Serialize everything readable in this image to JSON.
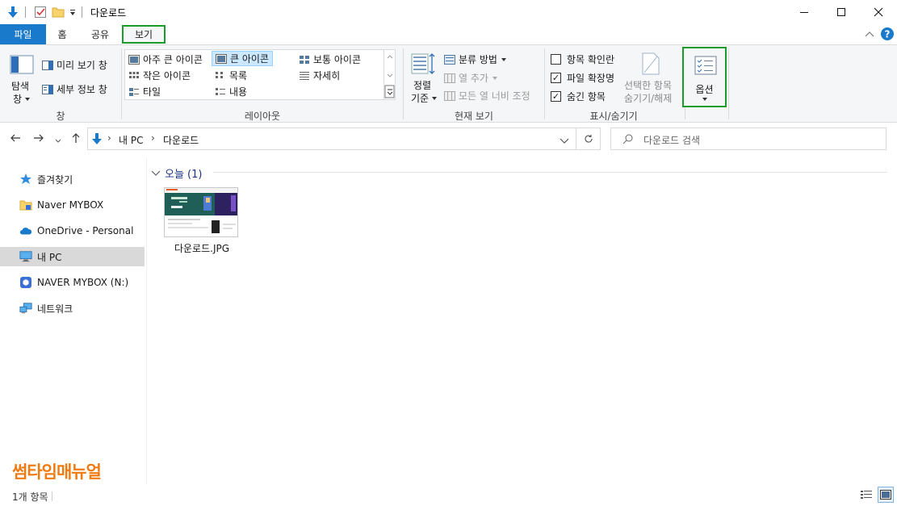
{
  "window": {
    "title": "다운로드"
  },
  "tabs": [
    {
      "label": "파일"
    },
    {
      "label": "홈"
    },
    {
      "label": "공유"
    },
    {
      "label": "보기"
    }
  ],
  "ribbon": {
    "pane": {
      "nav_pane_label_1": "탐색",
      "nav_pane_label_2": "창",
      "preview_label": "미리 보기 창",
      "details_label": "세부 정보 창",
      "group_label": "창"
    },
    "layout": {
      "items": [
        {
          "label": "아주 큰 아이콘"
        },
        {
          "label": "큰 아이콘"
        },
        {
          "label": "보통 아이콘"
        },
        {
          "label": "작은 아이콘"
        },
        {
          "label": "목록"
        },
        {
          "label": "자세히"
        },
        {
          "label": "타일"
        },
        {
          "label": "내용"
        }
      ],
      "group_label": "레이아웃"
    },
    "current_view": {
      "sort_label_1": "정렬",
      "sort_label_2": "기준",
      "group_by_label": "분류 방법",
      "add_column_label": "열 추가",
      "fit_columns_label": "모든 열 너비 조정",
      "group_label": "현재 보기"
    },
    "show_hide": {
      "checkboxes_label": "항목 확인란",
      "extensions_label": "파일 확장명",
      "hidden_label": "숨긴 항목",
      "hide_selected_1": "선택한 항목",
      "hide_selected_2": "숨기기/해제",
      "group_label": "표시/숨기기"
    },
    "options_label": "옵션"
  },
  "address": {
    "crumbs": [
      "내 PC",
      "다운로드"
    ],
    "search_placeholder": "다운로드 검색"
  },
  "sidebar": {
    "items": [
      {
        "label": "즐겨찾기"
      },
      {
        "label": "Naver MYBOX"
      },
      {
        "label": "OneDrive - Personal"
      },
      {
        "label": "내 PC"
      },
      {
        "label": "NAVER MYBOX (N:)"
      },
      {
        "label": "네트워크"
      }
    ]
  },
  "content": {
    "group_header": "오늘 (1)",
    "files": [
      {
        "name": "다운로드.JPG"
      }
    ]
  },
  "watermark": "썸타임매뉴얼",
  "status": {
    "count": "1개 항목"
  },
  "colors": {
    "file_tab": "#1979ca",
    "highlight_box": "#1a9c2c",
    "group_header": "#1e3287",
    "watermark": "#f07a12"
  }
}
